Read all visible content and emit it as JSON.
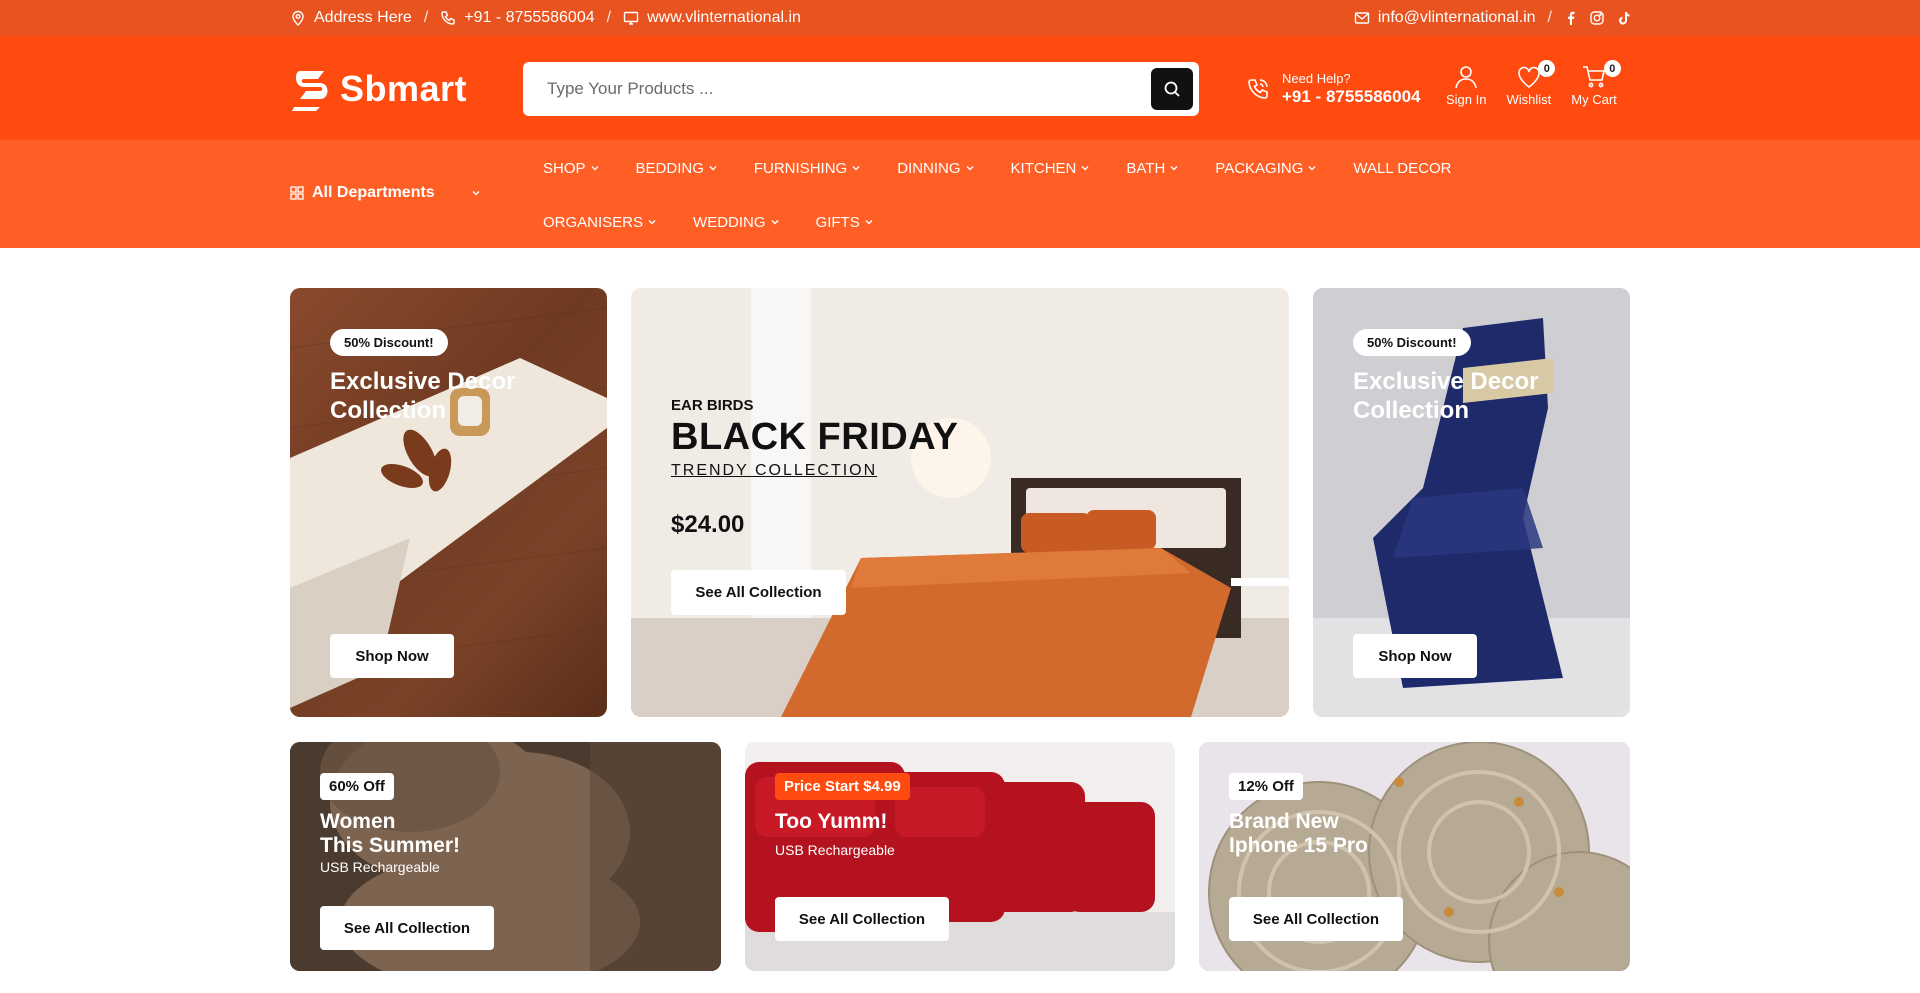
{
  "topbar": {
    "address": "Address Here",
    "phone": "+91 - 8755586004",
    "website": "www.vlinternational.in",
    "email": "info@vlinternational.in",
    "sep": "/"
  },
  "header": {
    "logo_text": "Sbmart",
    "search_placeholder": "Type Your Products ...",
    "help_label": "Need Help?",
    "help_phone": "+91 - 8755586004",
    "signin_label": "Sign In",
    "wishlist_label": "Wishlist",
    "wishlist_count": "0",
    "cart_label": "My Cart",
    "cart_count": "0"
  },
  "nav": {
    "departments_label": "All Departments",
    "items": [
      {
        "label": "SHOP"
      },
      {
        "label": "BEDDING"
      },
      {
        "label": "FURNISHING"
      },
      {
        "label": "DINNING"
      },
      {
        "label": "KITCHEN"
      },
      {
        "label": "BATH"
      },
      {
        "label": "PACKAGING"
      },
      {
        "label": "WALL DECOR"
      },
      {
        "label": "ORGANISERS"
      },
      {
        "label": "WEDDING"
      },
      {
        "label": "GIFTS"
      }
    ]
  },
  "banners": {
    "left": {
      "badge": "50% Discount!",
      "title": "Exclusive Decor Collection",
      "button": "Shop Now"
    },
    "center": {
      "eyebrow": "EAR BIRDS",
      "title": "BLACK FRIDAY",
      "subtitle": "TRENDY COLLECTION",
      "price": "$24.00",
      "button": "See All Collection"
    },
    "right": {
      "badge": "50% Discount!",
      "title": "Exclusive Decor Collection",
      "button": "Shop Now"
    }
  },
  "promos": [
    {
      "tag": "60% Off",
      "title1": "Women",
      "title2": "This Summer!",
      "sub": "USB Rechargeable",
      "button": "See All Collection"
    },
    {
      "tag": "Price Start $4.99",
      "title1": "Too Yumm!",
      "sub": "USB Rechargeable",
      "button": "See All Collection"
    },
    {
      "tag": "12% Off",
      "title1": "Brand New",
      "title2": "Iphone 15 Pro",
      "button": "See All Collection"
    }
  ],
  "colors": {
    "topbar": "#e8531f",
    "header": "#ff4a10",
    "nav": "#ff5e25"
  }
}
